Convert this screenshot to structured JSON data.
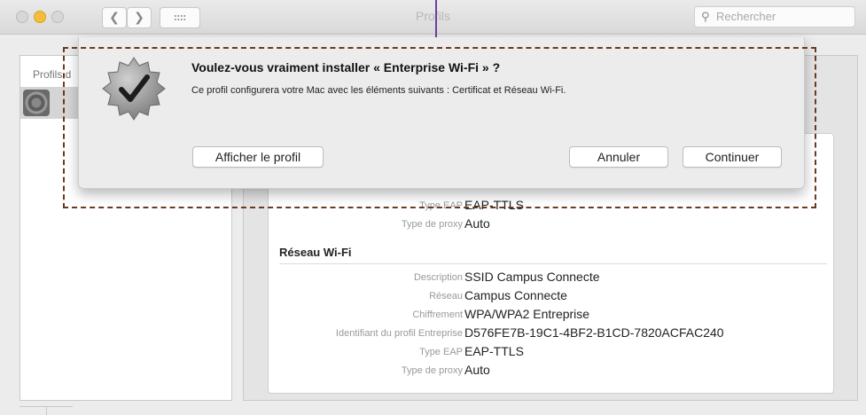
{
  "window": {
    "title": "Profils",
    "search_placeholder": "Rechercher"
  },
  "left_panel": {
    "header": "Profils d"
  },
  "details": {
    "partial_rows": [
      {
        "key": "Type EAP",
        "value": "EAP-TTLS"
      },
      {
        "key": "Type de proxy",
        "value": "Auto"
      }
    ],
    "wifi_section": {
      "title": "Réseau Wi-Fi",
      "rows": [
        {
          "key": "Description",
          "value": "SSID Campus Connecte"
        },
        {
          "key": "Réseau",
          "value": "Campus Connecte"
        },
        {
          "key": "Chiffrement",
          "value": "WPA/WPA2 Entreprise"
        },
        {
          "key": "Identifiant du profil Entreprise",
          "value": "D576FE7B-19C1-4BF2-B1CD-7820ACFAC240"
        },
        {
          "key": "Type EAP",
          "value": "EAP-TTLS"
        },
        {
          "key": "Type de proxy",
          "value": "Auto"
        }
      ]
    }
  },
  "dialog": {
    "title": "Voulez-vous vraiment installer « Enterprise Wi-Fi » ?",
    "message": "Ce profil configurera votre Mac avec les éléments suivants : Certificat et Réseau Wi-Fi.",
    "show_profile_label": "Afficher le profil",
    "cancel_label": "Annuler",
    "continue_label": "Continuer"
  },
  "colors": {
    "accent": "#f4bd3a",
    "annotation": "#6b3a1e",
    "cursor": "#6e3fa0"
  }
}
